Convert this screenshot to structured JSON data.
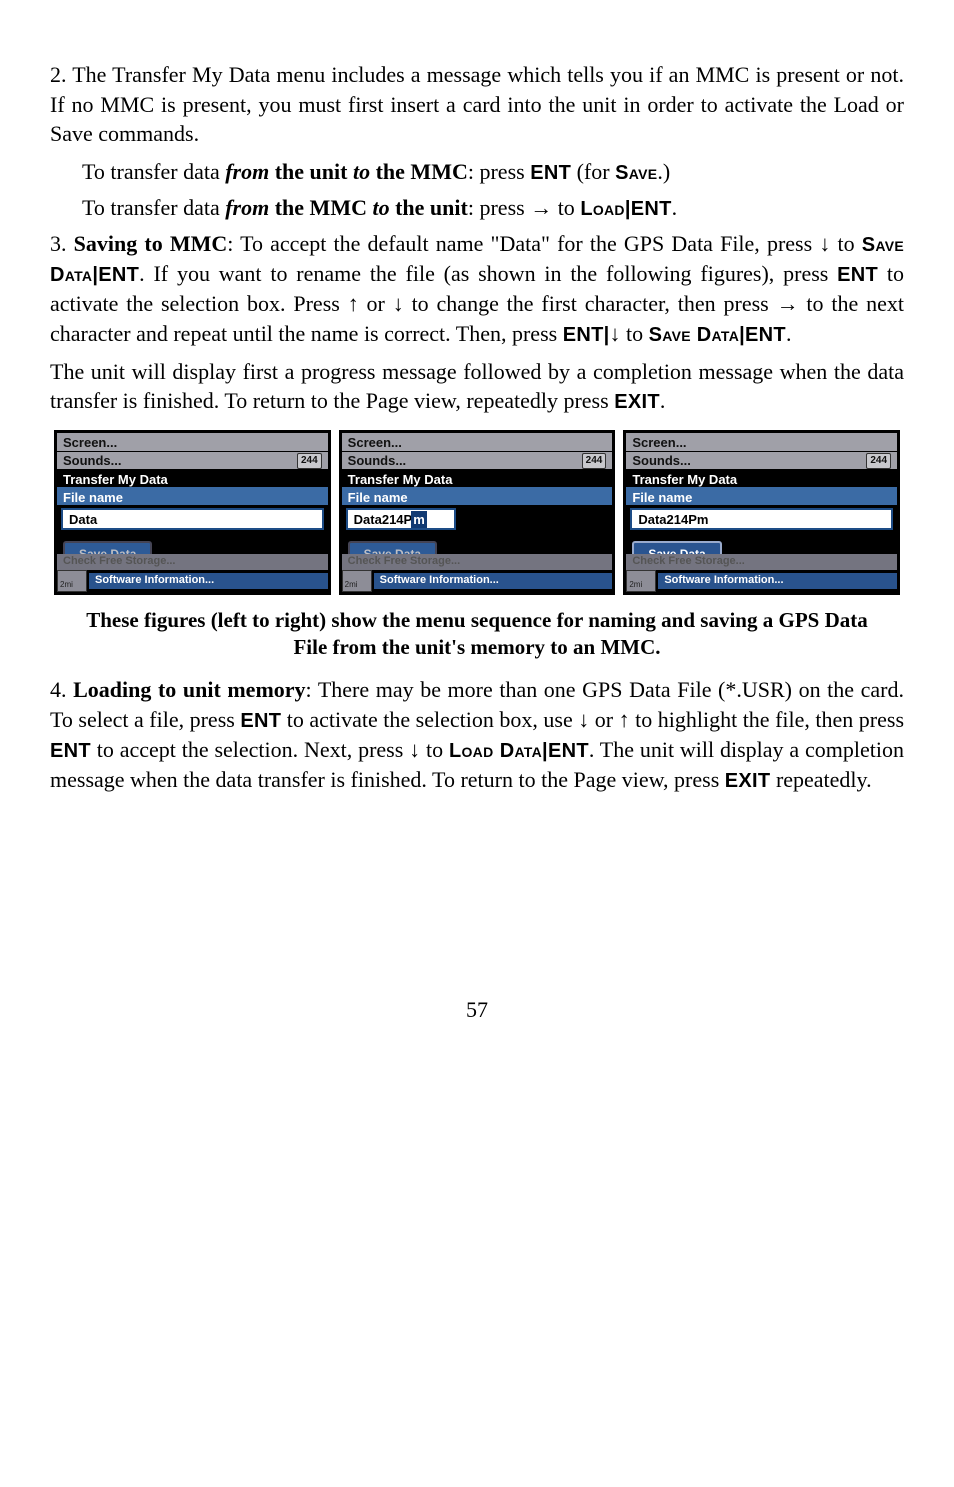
{
  "p1": "2. The Transfer My Data menu includes a message which tells you if an MMC is present or not. If no MMC is present, you must first insert a card into the unit in order to activate the Load or Save commands.",
  "p2a": "To transfer data ",
  "p2b": "from",
  "p2c": " the unit ",
  "p2d": "to",
  "p2e": " the MMC",
  "p2f": ": press ",
  "p2g": "ENT",
  "p2h": " (for ",
  "p2i": "Save",
  "p2j": ".)",
  "p3a": "To transfer data ",
  "p3b": "from",
  "p3c": " the MMC ",
  "p3d": "to",
  "p3e": " the unit",
  "p3f": ": press ",
  "p3arrow": "→",
  "p3g": " to ",
  "p3h": "Load",
  "p3i": "|",
  "p3j": "ENT",
  "p3k": ".",
  "p4a": "3. ",
  "p4b": "Saving to MMC",
  "p4c": ": To accept the default name \"Data\" for the GPS Data File, press ",
  "p4down": "↓",
  "p4d": " to ",
  "p4e": "Save Data",
  "p4f": "|",
  "p4g": "ENT",
  "p4h": ". If you want to rename the file (as shown in the following figures), press ",
  "p4i": "ENT",
  "p4j": " to activate the selection box. Press ",
  "p4up": "↑",
  "p4k": " or ",
  "p4down2": "↓",
  "p4l": " to change the first character, then press ",
  "p4right": "→",
  "p4m": " to the next character and repeat until the name is correct. Then, press ",
  "p4n": "ENT",
  "p4o": "|",
  "p4down3": "↓",
  "p4p": " to ",
  "p4q": "Save Data",
  "p4r": "|",
  "p4s": "ENT",
  "p4t": ".",
  "p5": "The unit will display first a progress message followed by a completion message when the data transfer is finished. To return to the Page view, repeatedly press ",
  "p5a": "EXIT",
  "p5b": ".",
  "caption": "These figures (left to right) show the menu sequence for naming and saving a GPS Data File from the unit's memory to an MMC.",
  "p6a": "4. ",
  "p6b": "Loading to unit memory",
  "p6c": ": There may be more than one GPS Data File (*.USR) on the card. To select a file, press ",
  "p6d": "ENT",
  "p6e": " to activate the selection box, use ",
  "p6down": "↓",
  "p6f": " or ",
  "p6up": "↑",
  "p6g": " to highlight the file, then press ",
  "p6h": "ENT",
  "p6i": " to accept the selection. Next, press ",
  "p6down2": "↓",
  "p6j": " to ",
  "p6k": "Load Data",
  "p6l": "|",
  "p6m": "ENT",
  "p6n": ". The unit will display a completion message when the data transfer is finished. To return to the Page view, press ",
  "p6o": "EXIT",
  "p6p": " repeatedly.",
  "page": "57",
  "screens": {
    "top1": "Screen...",
    "top2": "Sounds...",
    "badge": "244",
    "hdr": "Transfer My Data",
    "lbl": "File name",
    "f1": "Data",
    "f2a": "Data214P",
    "f2b": "m",
    "f3": "Data214Pm",
    "btn": "Save Data",
    "foot1": "Check Free Storage...",
    "foot2": "Software Information..."
  }
}
